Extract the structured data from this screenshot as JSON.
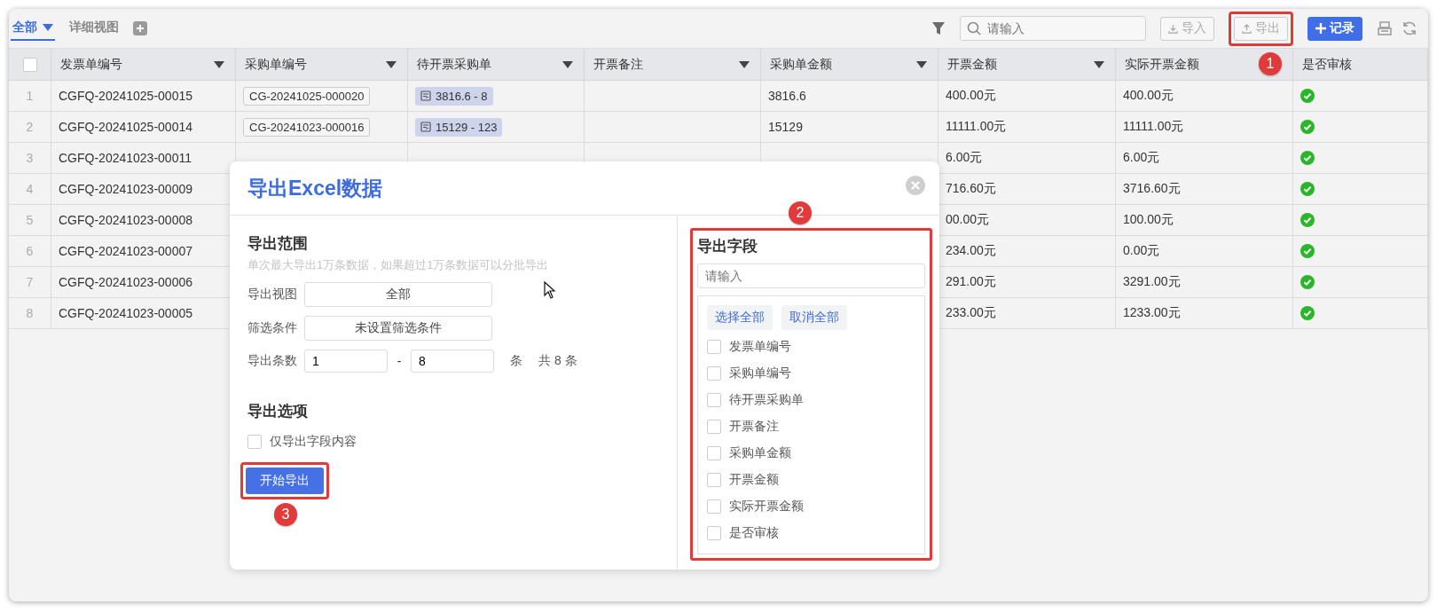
{
  "tabs": [
    {
      "label": "全部",
      "selected": true,
      "has_menu": true
    },
    {
      "label": "详细视图",
      "selected": false,
      "has_menu": false
    }
  ],
  "toolbar": {
    "search": {
      "placeholder": "请输入"
    },
    "buttons": [
      {
        "label": "导入",
        "kind": "import",
        "highlighted": false
      },
      {
        "label": "导出",
        "kind": "export",
        "highlighted": true
      },
      {
        "label": "记录",
        "kind": "add",
        "highlighted": false
      }
    ]
  },
  "table": {
    "select_all_checked": false,
    "columns": [
      {
        "label": "发票单编号",
        "kind": "text",
        "menu": true
      },
      {
        "label": "采购单编号",
        "kind": "tag",
        "menu": true
      },
      {
        "label": "待开票采购单",
        "kind": "chip",
        "menu": true
      },
      {
        "label": "开票备注",
        "kind": "text",
        "menu": true
      },
      {
        "label": "采购单金额",
        "kind": "text",
        "menu": true
      },
      {
        "label": "开票金额",
        "kind": "text",
        "menu": true
      },
      {
        "label": "实际开票金额",
        "kind": "text"
      },
      {
        "label": "是否审核",
        "kind": "check",
        "menu": false
      }
    ],
    "rows": [
      {
        "index": "1",
        "cells": [
          "CGFQ-20241025-00015",
          "CG-20241025-000020",
          "3816.6 - 8",
          null,
          "3816.6",
          "400.00元",
          "400.00元",
          true
        ]
      },
      {
        "index": "2",
        "cells": [
          "CGFQ-20241025-00014",
          "CG-20241023-000016",
          "15129 - 123",
          null,
          "15129",
          "11111.00元",
          "11111.00元",
          true
        ]
      },
      {
        "index": "3",
        "cells": [
          "CGFQ-20241023-00011",
          null,
          null,
          null,
          null,
          "6.00元",
          "6.00元",
          true
        ]
      },
      {
        "index": "4",
        "cells": [
          "CGFQ-20241023-00009",
          null,
          null,
          null,
          null,
          "716.60元",
          "3716.60元",
          true
        ]
      },
      {
        "index": "5",
        "cells": [
          "CGFQ-20241023-00008",
          null,
          null,
          null,
          null,
          "00.00元",
          "100.00元",
          true
        ]
      },
      {
        "index": "6",
        "cells": [
          "CGFQ-20241023-00007",
          null,
          null,
          null,
          null,
          "234.00元",
          "0.00元",
          true
        ]
      },
      {
        "index": "7",
        "cells": [
          "CGFQ-20241023-00006",
          null,
          null,
          null,
          null,
          "291.00元",
          "3291.00元",
          true
        ]
      },
      {
        "index": "8",
        "cells": [
          "CGFQ-20241023-00005",
          null,
          null,
          null,
          null,
          "233.00元",
          "1233.00元",
          true
        ]
      }
    ]
  },
  "export_dialog": {
    "title": "导出Excel数据",
    "range": {
      "heading": "导出范围",
      "hint": "单次最大导出1万条数据，如果超过1万条数据可以分批导出",
      "view_label": "导出视图",
      "view_value": "全部",
      "filter_label": "筛选条件",
      "filter_value": "未设置筛选条件",
      "count_label": "导出条数",
      "from": "1",
      "separator": "-",
      "to": "8",
      "unit": "条",
      "total": "共 8 条"
    },
    "options": {
      "heading": "导出选项",
      "items": [
        {
          "label": "仅导出字段内容",
          "checked": false
        }
      ]
    },
    "start_button": {
      "label": "开始导出",
      "highlighted": true
    },
    "fields": {
      "heading": "导出字段",
      "highlighted": true,
      "search_placeholder": "请输入",
      "select_all": "选择全部",
      "deselect_all": "取消全部",
      "items": [
        {
          "label": "发票单编号",
          "checked": false
        },
        {
          "label": "采购单编号",
          "checked": false
        },
        {
          "label": "待开票采购单",
          "checked": false
        },
        {
          "label": "开票备注",
          "checked": false
        },
        {
          "label": "采购单金额",
          "checked": false
        },
        {
          "label": "开票金额",
          "checked": false
        },
        {
          "label": "实际开票金额",
          "checked": false
        },
        {
          "label": "是否审核",
          "checked": false
        }
      ]
    }
  },
  "annotations": [
    {
      "number": "1"
    },
    {
      "number": "2"
    },
    {
      "number": "3"
    }
  ]
}
